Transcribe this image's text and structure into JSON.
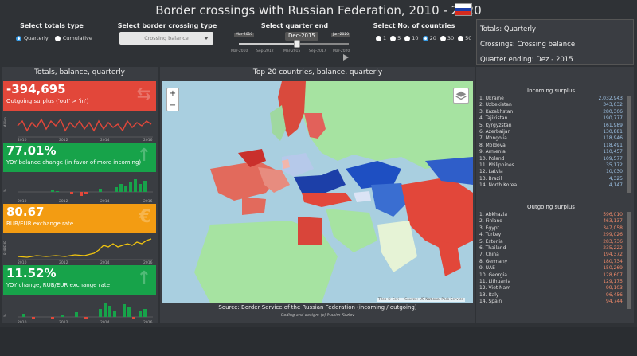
{
  "header": {
    "title": "Border crossings with Russian Federation, 2010 - 2020",
    "flag_colors": [
      "#ffffff",
      "#1c3fa8",
      "#d52b1e"
    ]
  },
  "controls": {
    "totals_type": {
      "title": "Select totals type",
      "options": [
        "Quarterly",
        "Cumulative"
      ],
      "selected": "Quarterly"
    },
    "border_type": {
      "title": "Select border crossing type",
      "value": "Crossing balance"
    },
    "quarter_end": {
      "title": "Select quarter end",
      "value": "Dec-2015",
      "min_label": "Mar-2010",
      "max_label": "Jun-2020",
      "ticks": [
        "Mar-2010",
        "Sep-2012",
        "Mar-2015",
        "Sep-2017",
        "Mar-2020"
      ],
      "position": 0.56
    },
    "countries": {
      "title": "Select No. of countries",
      "options": [
        "1",
        "5",
        "10",
        "20",
        "30",
        "50"
      ],
      "selected": "20"
    }
  },
  "info": {
    "line1": "Totals: Quarterly",
    "line2": "Crossings: Crossing balance",
    "line3": "Quarter ending: Dez - 2015"
  },
  "left_panel": {
    "title": "Totals, balance, quarterly",
    "kpis": [
      {
        "value": "-394,695",
        "desc": "Outgoing surplus ('out' > 'in')",
        "color": "#e2473a",
        "icon": "arrows-icon"
      },
      {
        "value": "77.01%",
        "desc": "YOY balance change (in favor of more incoming)",
        "color": "#17a34a",
        "icon": "arrow-up-icon"
      },
      {
        "value": "80.67",
        "desc": "RUB/EUR exchange rate",
        "color": "#f39c12",
        "icon": "euro-icon"
      },
      {
        "value": "11.52%",
        "desc": "YOY change, RUB/EUR exchange rate",
        "color": "#17a34a",
        "icon": "arrow-up-icon"
      }
    ],
    "spark_years": [
      "2010",
      "2012",
      "2014",
      "2016"
    ],
    "spark_axis": [
      "Million",
      "%",
      "RUB/EUR",
      "%"
    ]
  },
  "map_panel": {
    "title": "Top 20 countries, balance, quarterly",
    "zoom_in": "+",
    "zoom_out": "−",
    "attribution": "Tiles © Esri — Source: US National Park Service",
    "source": "Source: Border Service of the Russian Federation (incoming / outgoing)",
    "credit": "Coding and design: (c) Maxim Kozlov"
  },
  "incoming": {
    "title": "Incoming surplus",
    "rows": [
      [
        "1. Ukraine",
        "2,032,943"
      ],
      [
        "2. Uzbekistan",
        "343,032"
      ],
      [
        "3. Kazakhstan",
        "280,306"
      ],
      [
        "4. Tajikistan",
        "190,777"
      ],
      [
        "5. Kyrgyzstan",
        "161,989"
      ],
      [
        "6. Azerbaijan",
        "130,881"
      ],
      [
        "7. Mongolia",
        "118,946"
      ],
      [
        "8. Moldova",
        "118,491"
      ],
      [
        "9. Armenia",
        "110,457"
      ],
      [
        "10. Poland",
        "109,577"
      ],
      [
        "11. Philippines",
        "35,172"
      ],
      [
        "12. Latvia",
        "10,030"
      ],
      [
        "13. Brazil",
        "4,325"
      ],
      [
        "14. North Korea",
        "4,147"
      ]
    ]
  },
  "outgoing": {
    "title": "Outgoing surplus",
    "rows": [
      [
        "1. Abkhazia",
        "596,010"
      ],
      [
        "2. Finland",
        "463,137"
      ],
      [
        "3. Egypt",
        "347,058"
      ],
      [
        "4. Turkey",
        "299,026"
      ],
      [
        "5. Estonia",
        "283,736"
      ],
      [
        "6. Thailand",
        "235,222"
      ],
      [
        "7. China",
        "194,372"
      ],
      [
        "8. Germany",
        "180,734"
      ],
      [
        "9. UAE",
        "150,269"
      ],
      [
        "10. Georgia",
        "128,607"
      ],
      [
        "11. Lithuania",
        "129,175"
      ],
      [
        "12. Viet Nam",
        "99,103"
      ],
      [
        "13. Italy",
        "96,456"
      ],
      [
        "14. Spain",
        "94,744"
      ]
    ]
  }
}
